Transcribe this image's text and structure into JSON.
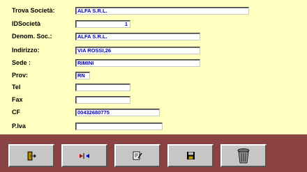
{
  "form": {
    "fields": [
      {
        "label": "Trova Società:",
        "value": "ALFA S.R.L."
      },
      {
        "label": "IDSocietà",
        "value": "1"
      },
      {
        "label": "Denom. Soc.:",
        "value": "ALFA S.R.L."
      },
      {
        "label": "Indirizzo:",
        "value": "VIA ROSSI,26"
      },
      {
        "label": "Sede :",
        "value": "RIMINI"
      },
      {
        "label": "Prov:",
        "value": "RN"
      },
      {
        "label": "Tel",
        "value": ""
      },
      {
        "label": "Fax",
        "value": ""
      },
      {
        "label": "CF",
        "value": "00432680775"
      },
      {
        "label": "P.Iva",
        "value": ""
      }
    ]
  },
  "toolbar": {
    "buttons": [
      {
        "icon": "exit-door-icon"
      },
      {
        "icon": "navigate-arrows-icon"
      },
      {
        "icon": "edit-note-icon"
      },
      {
        "icon": "save-disk-icon"
      },
      {
        "icon": "trash-bin-icon"
      }
    ]
  },
  "colors": {
    "form_background": "#ffffc0",
    "toolbar_background": "#8a4242",
    "value_text": "#0000c0"
  }
}
